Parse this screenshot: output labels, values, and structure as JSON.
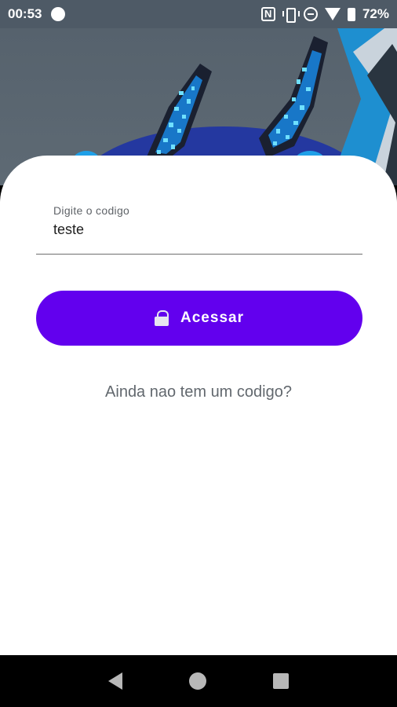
{
  "status_bar": {
    "time": "00:53",
    "battery": "72%",
    "icons": [
      "circle-icon",
      "nfc-icon",
      "vibrate-icon",
      "do-not-disturb-icon",
      "wifi-icon",
      "battery-icon"
    ]
  },
  "form": {
    "code_label": "Digite o codigo",
    "code_value": "teste",
    "access_button_label": "Acessar",
    "access_button_icon": "lock-icon",
    "no_code_link": "Ainda nao tem um codigo?"
  },
  "nav_bar": {
    "icons": [
      "back-icon",
      "home-icon",
      "recents-icon"
    ]
  },
  "colors": {
    "primary": "#6200ee",
    "header_bg": "#56626d",
    "link_text": "#62686e"
  }
}
